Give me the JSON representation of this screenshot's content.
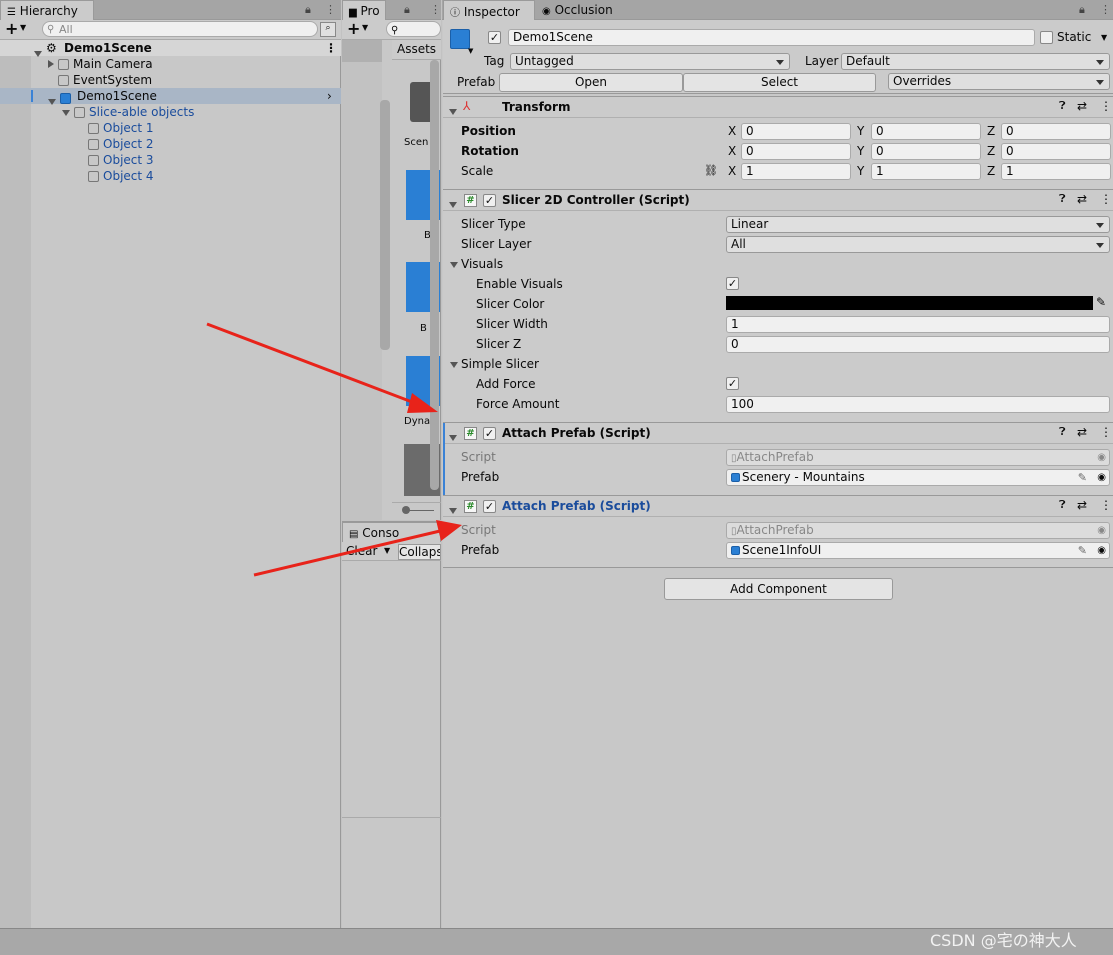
{
  "hierarchy": {
    "tab": "Hierarchy",
    "search_placeholder": "All",
    "scene": "Demo1Scene",
    "items": [
      "Main Camera",
      "EventSystem",
      "Demo1Scene",
      "Slice-able objects",
      "Object 1",
      "Object 2",
      "Object 3",
      "Object 4"
    ]
  },
  "project": {
    "tab": "Pro",
    "assets": "Assets",
    "labels": [
      "Scen",
      "B",
      "B",
      "Dyna"
    ]
  },
  "console": {
    "tab": "Conso",
    "clear": "Clear",
    "collapse": "Collaps"
  },
  "inspector": {
    "tabs": [
      "Inspector",
      "Occlusion"
    ],
    "object_name": "Demo1Scene",
    "static": "Static",
    "tag_label": "Tag",
    "tag": "Untagged",
    "layer_label": "Layer",
    "layer": "Default",
    "prefab_label": "Prefab",
    "open": "Open",
    "select": "Select",
    "overrides": "Overrides",
    "transform": {
      "title": "Transform",
      "position": "Position",
      "rotation": "Rotation",
      "scale": "Scale",
      "x": "X",
      "y": "Y",
      "z": "Z",
      "pos": [
        "0",
        "0",
        "0"
      ],
      "rot": [
        "0",
        "0",
        "0"
      ],
      "scl": [
        "1",
        "1",
        "1"
      ]
    },
    "slicer": {
      "title": "Slicer 2D Controller (Script)",
      "slicer_type": "Slicer Type",
      "slicer_type_val": "Linear",
      "slicer_layer": "Slicer Layer",
      "slicer_layer_val": "All",
      "visuals": "Visuals",
      "enable_visuals": "Enable Visuals",
      "slicer_color": "Slicer Color",
      "color_val": "#000000",
      "slicer_width": "Slicer Width",
      "slicer_width_val": "1",
      "slicer_z": "Slicer Z",
      "slicer_z_val": "0",
      "simple_slicer": "Simple Slicer",
      "add_force": "Add Force",
      "force_amount": "Force Amount",
      "force_amount_val": "100"
    },
    "attach1": {
      "title": "Attach Prefab (Script)",
      "script_label": "Script",
      "script_val": "AttachPrefab",
      "prefab_label": "Prefab",
      "prefab_val": "Scenery - Mountains"
    },
    "attach2": {
      "title": "Attach Prefab (Script)",
      "script_label": "Script",
      "script_val": "AttachPrefab",
      "prefab_label": "Prefab",
      "prefab_val": "Scene1InfoUI"
    },
    "add_component": "Add Component"
  },
  "watermark": "CSDN @宅の神大人",
  "colors": {
    "accent": "#1a4c9c",
    "arrow": "#e8231a",
    "selection": "#a9b6c6"
  }
}
